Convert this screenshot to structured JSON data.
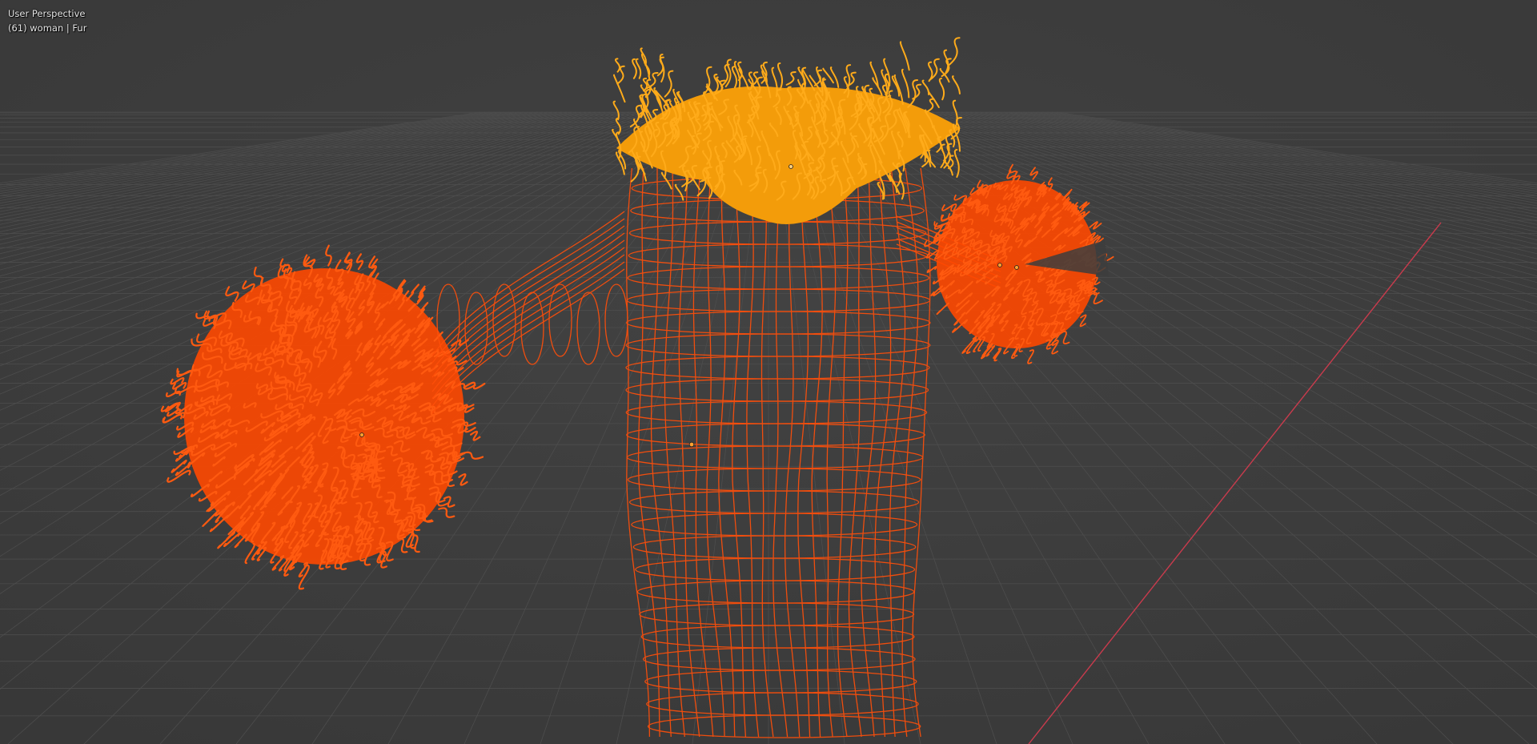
{
  "viewport": {
    "view_label": "User Perspective",
    "object_info": "(61) woman | Fur",
    "background_color": "#3d3d3d",
    "grid_color": "#4a4a4a",
    "x_axis_color": "#c93b4d",
    "wire_color": "#ff4f0a",
    "active_hair_color": "#ffa500",
    "selected_hair_color": "#ff4800"
  }
}
